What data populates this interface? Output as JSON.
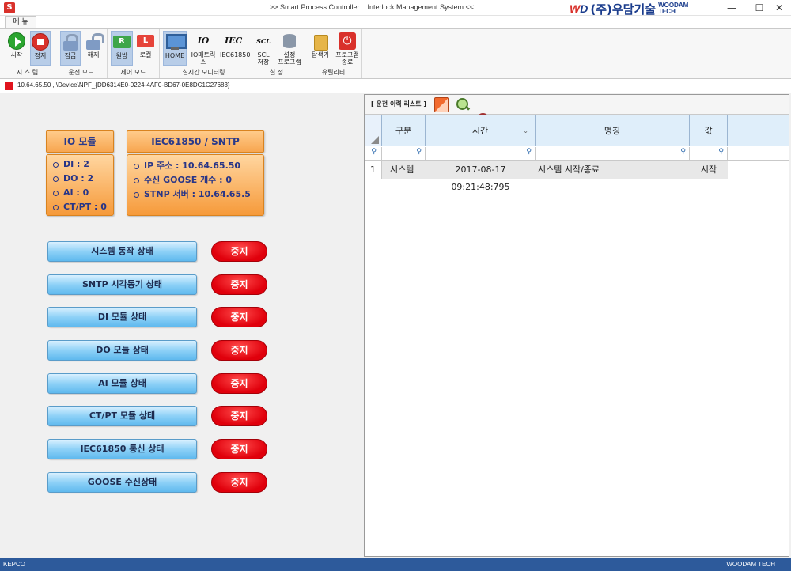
{
  "window": {
    "title": ">> Smart Process Controller :: Interlock Management System <<",
    "app_icon": "S",
    "logo_mark_w": "W",
    "logo_mark_d": "D",
    "logo_kr": "(주)우담기술",
    "logo_en": "WOODAM TECH",
    "minimize": "—",
    "maximize": "☐",
    "close": "✕"
  },
  "ribbon": {
    "tab": "메 뉴",
    "groups": {
      "system": {
        "label": "시 스 템",
        "start": "시작",
        "stop": "정지"
      },
      "operation": {
        "label": "운전 모드",
        "lock": "잠금",
        "unlock": "해제"
      },
      "control": {
        "label": "제어 모드",
        "remote": "원방",
        "remote_icon": "R",
        "local": "로컬",
        "local_icon": "L"
      },
      "monitoring": {
        "label": "실시간 모니터링",
        "home": "HOME",
        "io_matrix": "IO매트릭스",
        "io_icon": "IO",
        "iec": "IEC61850",
        "iec_icon": "IEC"
      },
      "settings": {
        "label": "설 정",
        "scl_line1": "SCL",
        "scl_line2": "저장",
        "scl_icon": "SCL",
        "config_line1": "설정",
        "config_line2": "프로그램"
      },
      "utility": {
        "label": "유틸리티",
        "explorer": "탐색기",
        "exit_line1": "프로그램",
        "exit_line2": "종료"
      }
    }
  },
  "connection": {
    "text": "10.64.65.50 , \\Device\\NPF_{DD6314E0-0224-4AF0-BD67-0E8DC1C27683}",
    "status_color": "#e0141e"
  },
  "io_module": {
    "title": "IO 모듈",
    "lines": [
      "DI : 2",
      "DO : 2",
      "AI : 0",
      "CT/PT : 0"
    ]
  },
  "iec_module": {
    "title": "IEC61850 / SNTP",
    "lines": [
      "IP 주소 : 10.64.65.50",
      "수신 GOOSE 개수 : 0",
      "STNP 서버 : 10.64.65.5"
    ]
  },
  "status_rows": [
    {
      "label": "시스템 동작 상태",
      "value": "중지"
    },
    {
      "label": "SNTP 시각동기 상태",
      "value": "중지"
    },
    {
      "label": "DI 모듈 상태",
      "value": "중지"
    },
    {
      "label": "DO 모듈 상태",
      "value": "중지"
    },
    {
      "label": "AI 모듈 상태",
      "value": "중지"
    },
    {
      "label": "CT/PT 모듈 상태",
      "value": "중지"
    },
    {
      "label": "IEC61850 통신 상태",
      "value": "중지"
    },
    {
      "label": "GOOSE 수신상태",
      "value": "중지"
    }
  ],
  "history": {
    "title": "[ 운전 이력 리스트 ]",
    "columns": [
      "구분",
      "시간",
      "명칭",
      "값"
    ],
    "sort_indicator": "⌄",
    "filter_icon": "⚲",
    "rows": [
      {
        "num": "1",
        "type": "시스템",
        "time": "2017-08-17 09:21:48:795",
        "name": "시스템 시작/종료",
        "value": "시작"
      }
    ]
  },
  "statusbar": {
    "left": "KEPCO",
    "right": "WOODAM TECH"
  }
}
